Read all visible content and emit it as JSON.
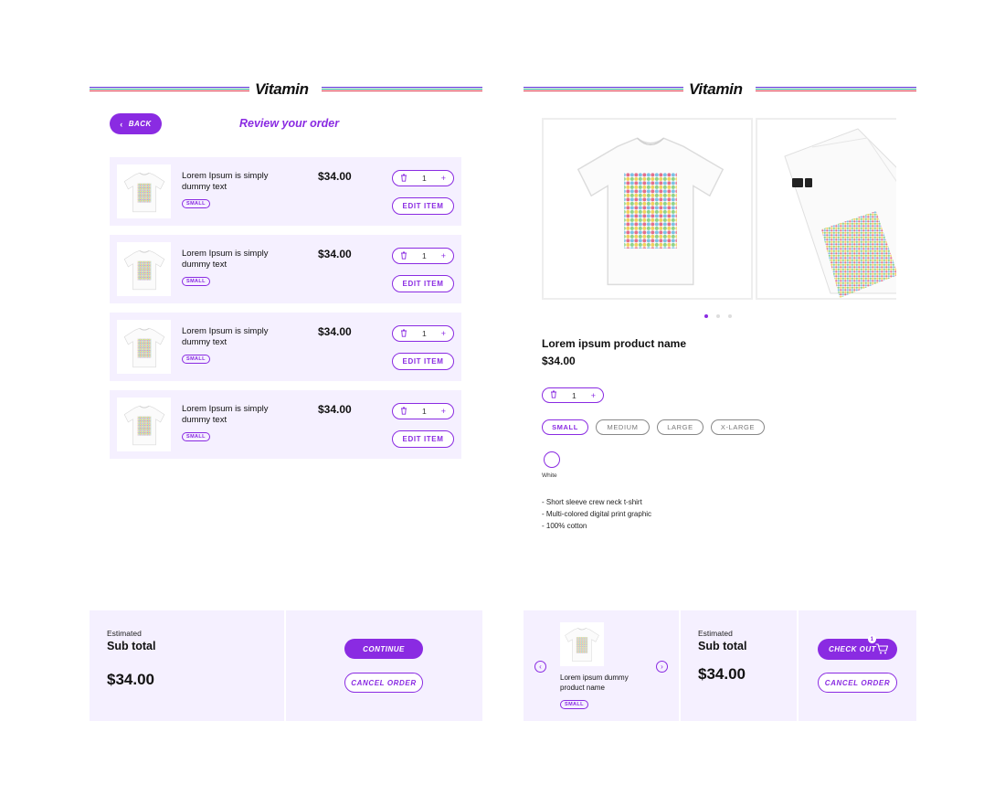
{
  "brand": {
    "logo": "Vitamin",
    "accent": "#8a2be2",
    "panel_bg": "#f5f0ff"
  },
  "review": {
    "back_label": "BACK",
    "title": "Review your order",
    "items": [
      {
        "name": "Lorem Ipsum is simply dummy text",
        "size": "SMALL",
        "price": "$34.00",
        "qty": "1",
        "edit_label": "EDIT ITEM"
      },
      {
        "name": "Lorem Ipsum is simply dummy text",
        "size": "SMALL",
        "price": "$34.00",
        "qty": "1",
        "edit_label": "EDIT ITEM"
      },
      {
        "name": "Lorem Ipsum is simply dummy text",
        "size": "SMALL",
        "price": "$34.00",
        "qty": "1",
        "edit_label": "EDIT ITEM"
      },
      {
        "name": "Lorem Ipsum is simply dummy text",
        "size": "SMALL",
        "price": "$34.00",
        "qty": "1",
        "edit_label": "EDIT ITEM"
      }
    ],
    "summary": {
      "estimated_label": "Estimated",
      "subtotal_label": "Sub total",
      "total": "$34.00",
      "continue_label": "CONTINUE",
      "cancel_label": "CANCEL ORDER"
    }
  },
  "product": {
    "name": "Lorem ipsum product name",
    "price": "$34.00",
    "qty": "1",
    "carousel_dots": 3,
    "active_dot": 0,
    "sizes": [
      "SMALL",
      "MEDIUM",
      "LARGE",
      "X-LARGE"
    ],
    "selected_size": "SMALL",
    "color_label": "White",
    "features": [
      "- Short sleeve crew neck t-shirt",
      "- Multi-colored digital print graphic",
      "- 100% cotton"
    ]
  },
  "checkout_bar": {
    "item_name": "Lorem ipsum dummy product name",
    "item_size": "SMALL",
    "estimated_label": "Estimated",
    "subtotal_label": "Sub total",
    "total": "$34.00",
    "checkout_label": "CHECK OUT",
    "cart_count": "1",
    "cancel_label": "CANCEL ORDER"
  },
  "icons": {
    "back": "chevron-left-icon",
    "trash": "trash-icon",
    "plus": "plus-icon",
    "prev": "chevron-left-icon",
    "next": "chevron-right-icon",
    "cart": "cart-icon"
  }
}
